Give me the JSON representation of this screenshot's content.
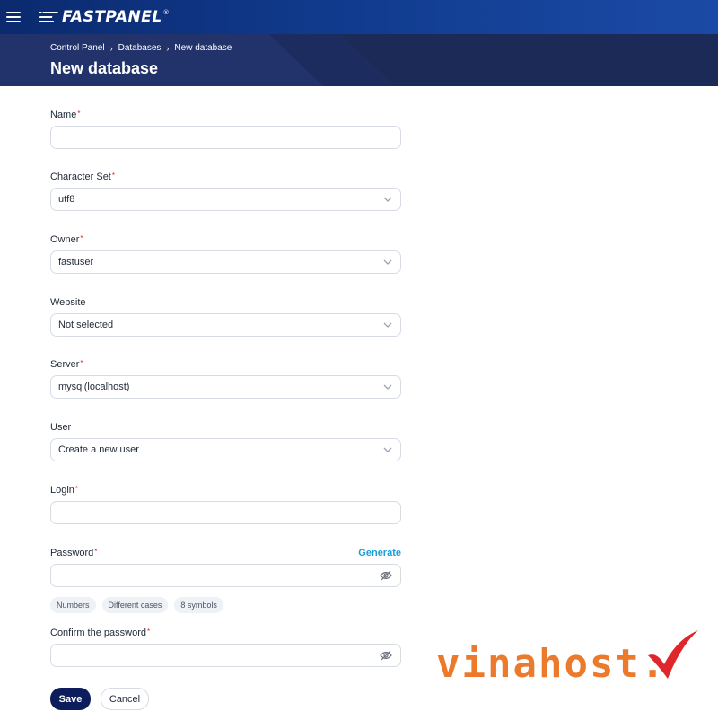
{
  "app": {
    "logo_text": "FASTPANEL",
    "logo_reg": "®"
  },
  "breadcrumb": {
    "items": [
      "Control Panel",
      "Databases",
      "New database"
    ],
    "separator": "›"
  },
  "page": {
    "title": "New database"
  },
  "form": {
    "name": {
      "label": "Name",
      "value": ""
    },
    "charset": {
      "label": "Character Set",
      "value": "utf8"
    },
    "owner": {
      "label": "Owner",
      "value": "fastuser"
    },
    "website": {
      "label": "Website",
      "value": "Not selected"
    },
    "server": {
      "label": "Server",
      "value": "mysql(localhost)"
    },
    "user": {
      "label": "User",
      "value": "Create a new user"
    },
    "login": {
      "label": "Login",
      "value": ""
    },
    "password": {
      "label": "Password",
      "value": "",
      "generate_label": "Generate"
    },
    "password_hints": [
      "Numbers",
      "Different cases",
      "8 symbols"
    ],
    "confirm": {
      "label": "Confirm the password",
      "value": ""
    },
    "required_mark": "*"
  },
  "actions": {
    "save_label": "Save",
    "cancel_label": "Cancel"
  },
  "watermark": {
    "text": "vinahost."
  },
  "colors": {
    "topbar": "#103a8c",
    "header": "#1b2a57",
    "primary_button": "#0d1d5c",
    "link": "#1b9fd8",
    "required": "#e02424",
    "watermark_orange": "#ec7a2d",
    "watermark_red": "#e0252b"
  },
  "icons": {
    "menu": "hamburger-icon",
    "logo": "fastpanel-logo-icon",
    "dropdown": "chevron-down-icon",
    "visibility": "eye-off-icon",
    "checkmark": "checkmark-icon"
  }
}
